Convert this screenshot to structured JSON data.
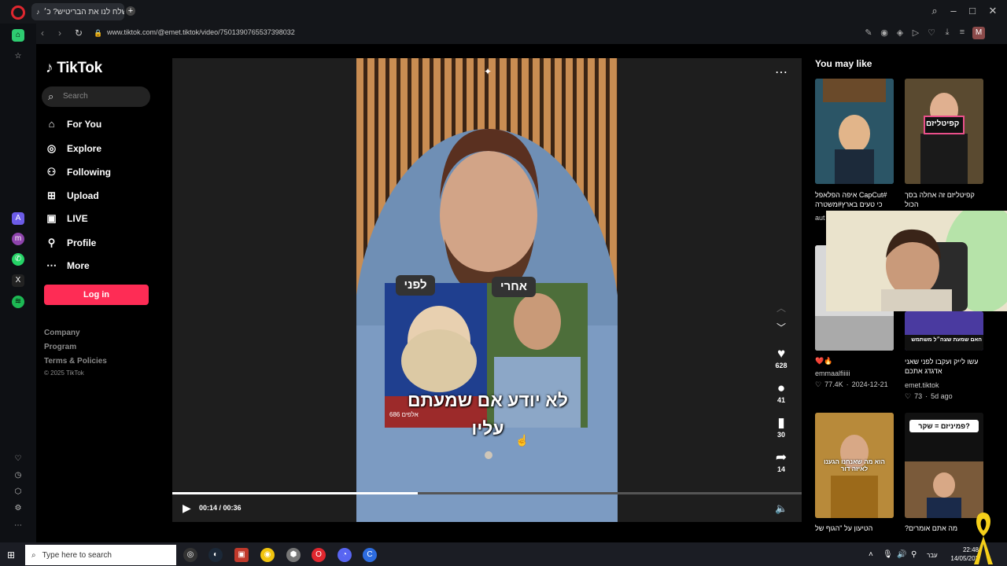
{
  "browser": {
    "tab_title": "ישלח לנו את הבריטיש? כ׳",
    "new_tab": "+",
    "url": "www.tiktok.com/@emet.tiktok/video/7501390765537398032",
    "profile_initial": "M"
  },
  "nav": {
    "logo": "TikTok",
    "search_placeholder": "Search",
    "items": [
      {
        "label": "For You",
        "icon": "home-icon"
      },
      {
        "label": "Explore",
        "icon": "compass-icon"
      },
      {
        "label": "Following",
        "icon": "following-icon"
      },
      {
        "label": "Upload",
        "icon": "upload-icon"
      },
      {
        "label": "LIVE",
        "icon": "live-icon"
      },
      {
        "label": "Profile",
        "icon": "profile-icon"
      },
      {
        "label": "More",
        "icon": "more-icon"
      }
    ],
    "login": "Log in",
    "footer": [
      "Company",
      "Program",
      "Terms & Policies"
    ],
    "copyright": "© 2025 TikTok"
  },
  "video": {
    "before_label": "לפני",
    "after_label": "אחרי",
    "caption_line1": "לא יודע אם שמעתם",
    "caption_line2": "עליו",
    "overlay_small_left": "686 אלפים",
    "time": "00:14 / 00:36",
    "progress": 0.39,
    "likes": "628",
    "comments": "41",
    "saves": "30",
    "shares": "14"
  },
  "sidebar": {
    "title": "You may like",
    "cards": [
      {
        "caption": "#CapCut איפה הפלאפל כי טעים בארץ#משטרה",
        "meta": "aut"
      },
      {
        "caption": "קפיטליזם זה אחלה בסך הכול",
        "overlay": "קפיטליזם",
        "meta": ""
      },
      {
        "caption": "❤️🔥",
        "author": "emmaalfiiiii",
        "likes": "77.4K",
        "date": "2024-12-21"
      },
      {
        "caption": "עשו לייק ועקבו לפני שאני אדגדג אתכם",
        "author": "emet.tiktok",
        "likes": "73",
        "date": "5d ago",
        "overlay": "האם שמעת שצה״ל משתמש"
      },
      {
        "caption": "הטיעון על \"הגוף של",
        "overlay": "הוא מה שאנחנו הגענו לאיזה דור"
      },
      {
        "caption": "מה אתם אומרים?",
        "overlay": "פמיניזם = שקר?"
      }
    ]
  },
  "taskbar": {
    "search_placeholder": "Type here to search",
    "time": "22:48",
    "date": "14/05/202",
    "lang": "עבר"
  }
}
